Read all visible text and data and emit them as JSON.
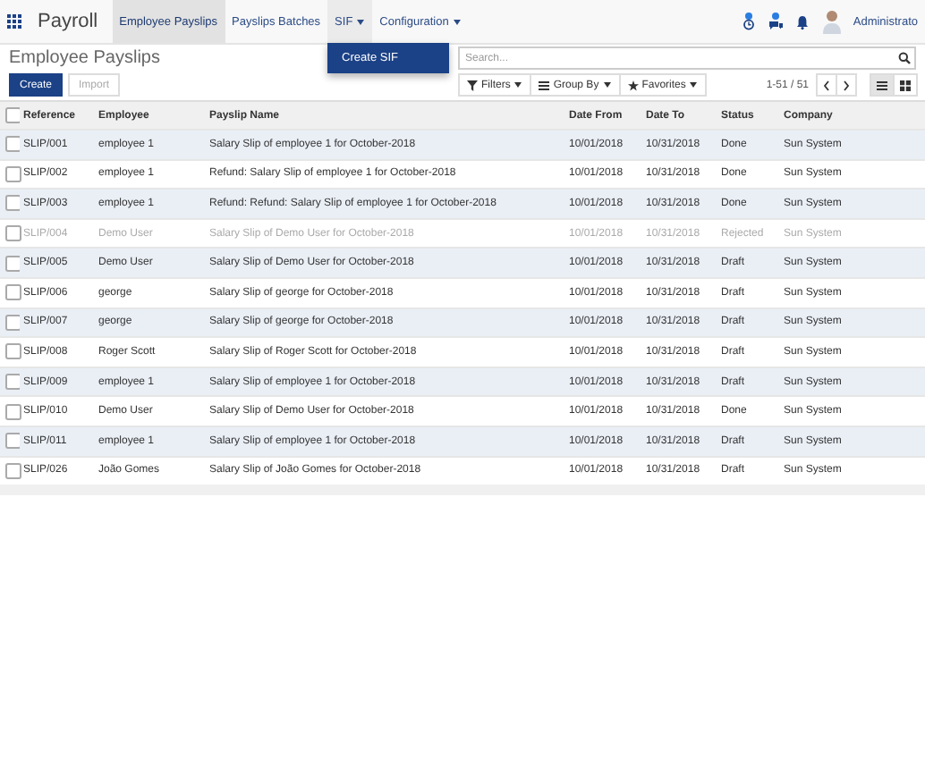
{
  "navbar": {
    "app_name": "Payroll",
    "menu": [
      {
        "label": "Employee Payslips",
        "selected": true,
        "open": false,
        "caret": false
      },
      {
        "label": "Payslips Batches",
        "selected": false,
        "open": false,
        "caret": false
      },
      {
        "label": "SIF",
        "selected": false,
        "open": true,
        "caret": true,
        "dropdown": [
          "Create SIF"
        ]
      },
      {
        "label": "Configuration",
        "selected": false,
        "open": false,
        "caret": true
      }
    ],
    "user": "Administrato"
  },
  "breadcrumb": "Employee Payslips",
  "buttons": [
    {
      "label": "Create",
      "kind": "primary"
    },
    {
      "label": "Import",
      "kind": "secondary"
    }
  ],
  "search": {
    "placeholder": "Search..."
  },
  "filters": [
    {
      "label": "Filters"
    },
    {
      "label": "Group By"
    },
    {
      "label": "Favorites"
    }
  ],
  "pager": "1-51 / 51",
  "views": [
    {
      "kind": "list",
      "selected": true
    },
    {
      "kind": "kanban",
      "selected": false
    }
  ],
  "table": {
    "all_checked": false,
    "columns": [
      "Reference",
      "Employee",
      "Payslip Name",
      "Date From",
      "Date To",
      "Status",
      "Company"
    ],
    "rows": [
      {
        "muted": false,
        "checked": false,
        "cells": [
          "SLIP/001",
          "employee 1",
          "Salary Slip of employee 1 for October-2018",
          "10/01/2018",
          "10/31/2018",
          "Done",
          "Sun System"
        ]
      },
      {
        "muted": false,
        "checked": false,
        "cells": [
          "SLIP/002",
          "employee 1",
          "Refund: Salary Slip of employee 1 for October-2018",
          "10/01/2018",
          "10/31/2018",
          "Done",
          "Sun System"
        ]
      },
      {
        "muted": false,
        "checked": false,
        "cells": [
          "SLIP/003",
          "employee 1",
          "Refund: Refund: Salary Slip of employee 1 for October-2018",
          "10/01/2018",
          "10/31/2018",
          "Done",
          "Sun System"
        ]
      },
      {
        "muted": true,
        "checked": false,
        "cells": [
          "SLIP/004",
          "Demo User",
          "Salary Slip of Demo User for October-2018",
          "10/01/2018",
          "10/31/2018",
          "Rejected",
          "Sun System"
        ]
      },
      {
        "muted": false,
        "checked": false,
        "cells": [
          "SLIP/005",
          "Demo User",
          "Salary Slip of Demo User for October-2018",
          "10/01/2018",
          "10/31/2018",
          "Draft",
          "Sun System"
        ]
      },
      {
        "muted": false,
        "checked": false,
        "cells": [
          "SLIP/006",
          "george",
          "Salary Slip of george for October-2018",
          "10/01/2018",
          "10/31/2018",
          "Draft",
          "Sun System"
        ]
      },
      {
        "muted": false,
        "checked": false,
        "cells": [
          "SLIP/007",
          "george",
          "Salary Slip of george for October-2018",
          "10/01/2018",
          "10/31/2018",
          "Draft",
          "Sun System"
        ]
      },
      {
        "muted": false,
        "checked": false,
        "cells": [
          "SLIP/008",
          "Roger Scott",
          "Salary Slip of Roger Scott for October-2018",
          "10/01/2018",
          "10/31/2018",
          "Draft",
          "Sun System"
        ]
      },
      {
        "muted": false,
        "checked": false,
        "cells": [
          "SLIP/009",
          "employee 1",
          "Salary Slip of employee 1 for October-2018",
          "10/01/2018",
          "10/31/2018",
          "Draft",
          "Sun System"
        ]
      },
      {
        "muted": false,
        "checked": false,
        "cells": [
          "SLIP/010",
          "Demo User",
          "Salary Slip of Demo User for October-2018",
          "10/01/2018",
          "10/31/2018",
          "Done",
          "Sun System"
        ]
      },
      {
        "muted": false,
        "checked": false,
        "cells": [
          "SLIP/011",
          "employee 1",
          "Salary Slip of employee 1 for October-2018",
          "10/01/2018",
          "10/31/2018",
          "Draft",
          "Sun System"
        ]
      },
      {
        "muted": false,
        "checked": false,
        "cells": [
          "SLIP/026",
          "João Gomes",
          "Salary Slip of João Gomes for October-2018",
          "10/01/2018",
          "10/31/2018",
          "Draft",
          "Sun System"
        ]
      }
    ]
  }
}
